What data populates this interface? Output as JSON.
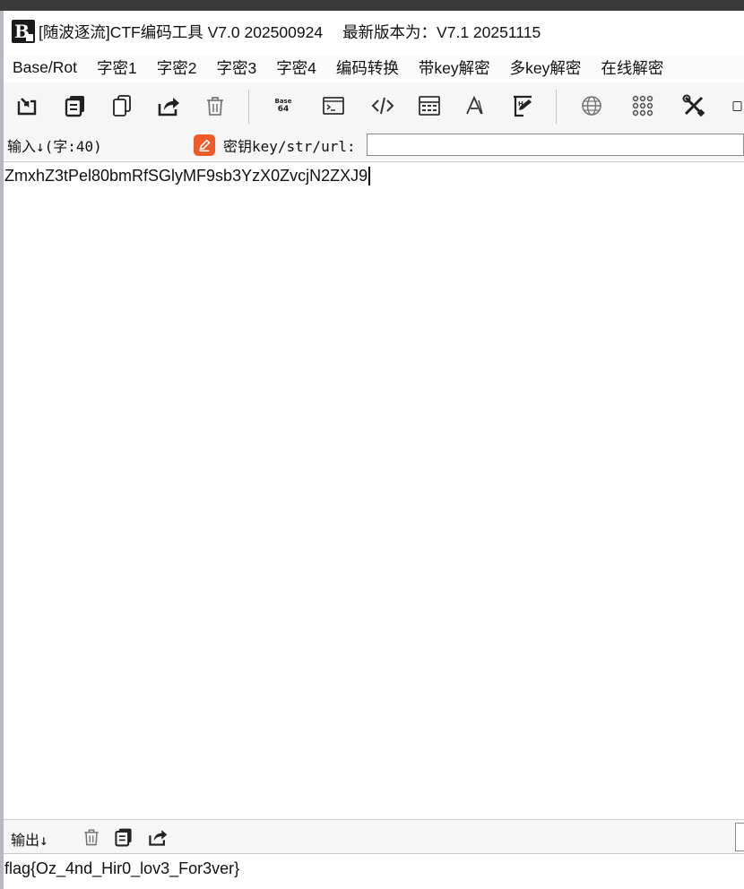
{
  "window": {
    "title": "[随波逐流]CTF编码工具 V7.0 202500924",
    "latest_version": "最新版本为：V7.1  20251115",
    "app_icon_letter": "B"
  },
  "menu": {
    "items": [
      "Base/Rot",
      "字密1",
      "字密2",
      "字密3",
      "字密4",
      "编码转换",
      "带key解密",
      "多key解密",
      "在线解密"
    ]
  },
  "toolbar": {
    "icons": [
      "import-icon",
      "copy-icon",
      "paste-icon",
      "share-icon",
      "trash-icon",
      "base64-icon",
      "terminal-icon",
      "code-icon",
      "calculator-icon",
      "font-icon",
      "hex-editor-icon",
      "globe-icon",
      "grid-icon",
      "tools-icon"
    ],
    "base64_line1": "Base",
    "base64_line2": "64"
  },
  "input": {
    "label": "输入↓(字:40)",
    "value": "ZmxhZ3tPel80bmRfSGlyMF9sb3YzX0ZvcjN2ZXJ9"
  },
  "key": {
    "label": "密钥key/str/url:",
    "value": "",
    "placeholder": ""
  },
  "output": {
    "label": "输出↓",
    "value": "flag{Oz_4nd_Hir0_lov3_For3ver}"
  },
  "colors": {
    "key_icon": "#f05a28",
    "title_bar_dark": "#3a3a3a",
    "toolbar_bg": "#f6f6f6"
  }
}
